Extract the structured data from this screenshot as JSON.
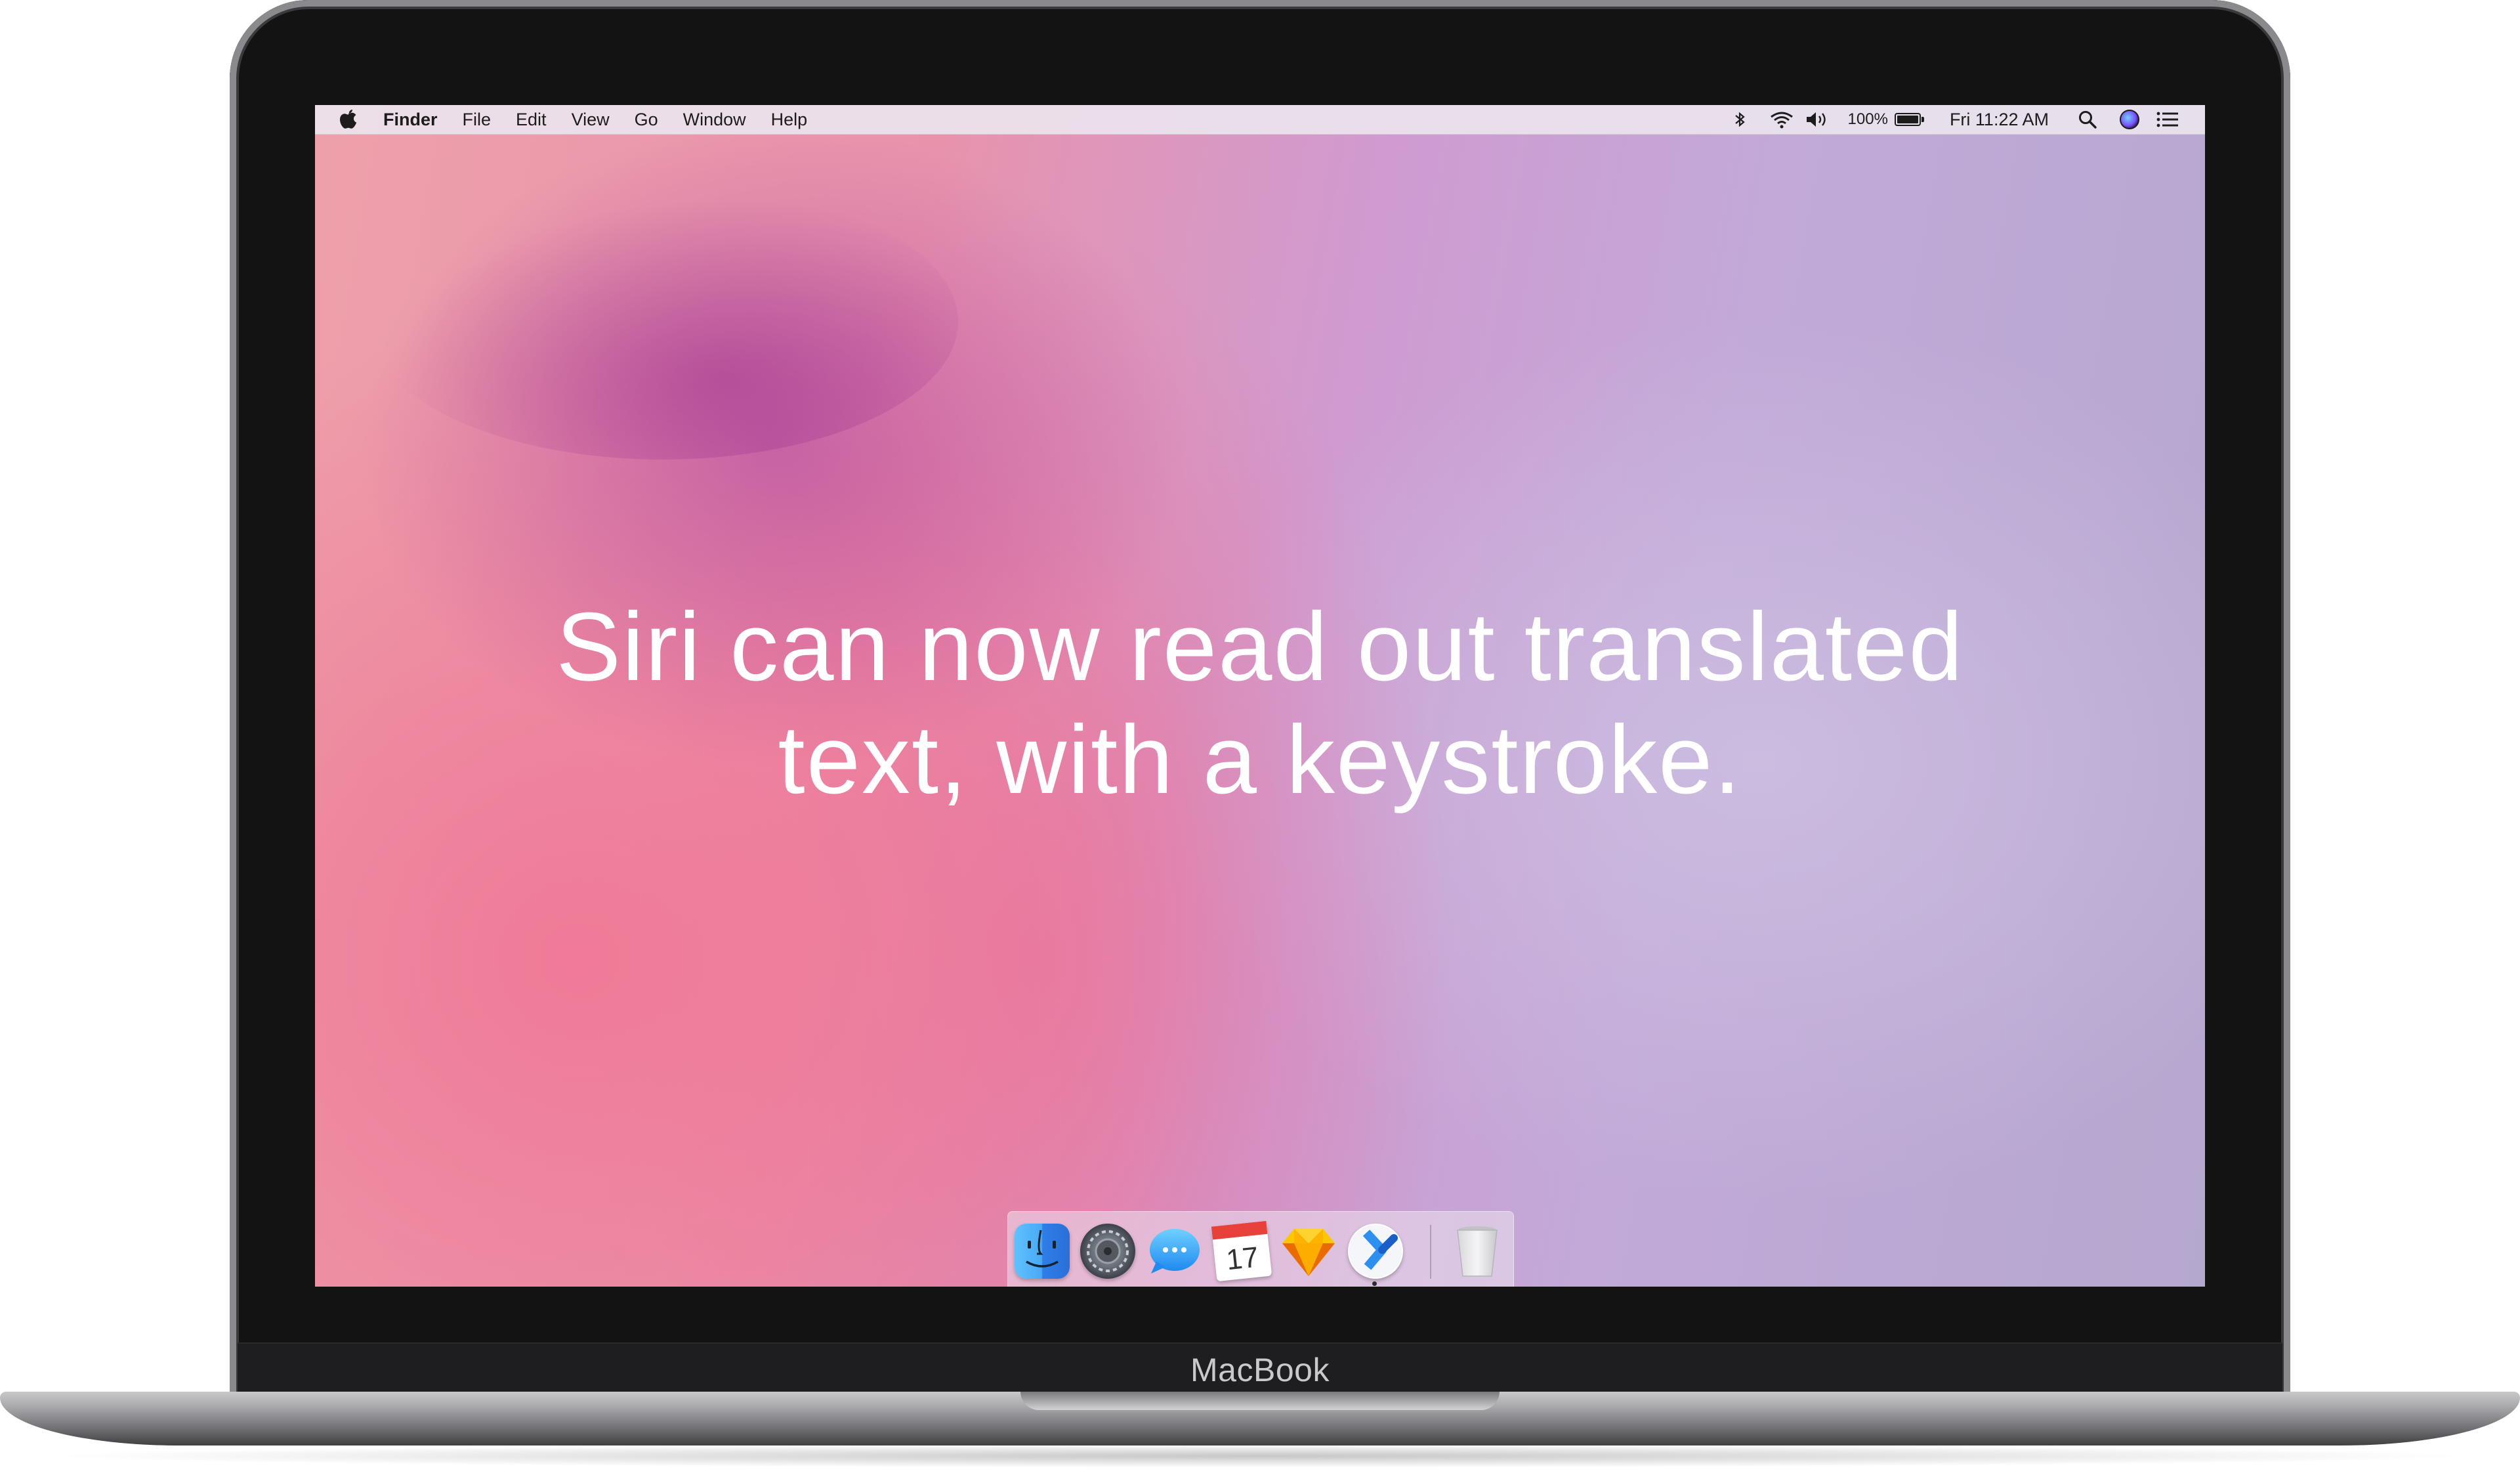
{
  "device": {
    "brand_label": "MacBook"
  },
  "menubar": {
    "app_name": "Finder",
    "menus": [
      "File",
      "Edit",
      "View",
      "Go",
      "Window",
      "Help"
    ],
    "battery_percent": "100%",
    "clock": "Fri 11:22 AM",
    "status_icons": [
      "bluetooth-icon",
      "wifi-icon",
      "volume-icon",
      "battery-icon",
      "spotlight-search-icon",
      "siri-icon",
      "notification-center-icon"
    ]
  },
  "headline": {
    "line1": "Siri can now read out translated",
    "line2": "text, with a keystroke."
  },
  "dock": {
    "apps": [
      {
        "name": "finder-icon"
      },
      {
        "name": "system-preferences-icon"
      },
      {
        "name": "messages-icon"
      },
      {
        "name": "calendar-icon",
        "label": "17"
      },
      {
        "name": "sketch-icon"
      },
      {
        "name": "translate-app-icon"
      },
      {
        "name": "trash-icon"
      }
    ]
  },
  "colors": {
    "wallpaper_pink": "#eea0aa",
    "wallpaper_lavender": "#c2a9d8",
    "bezel": "#131313",
    "menubar": "#ece4ee"
  }
}
